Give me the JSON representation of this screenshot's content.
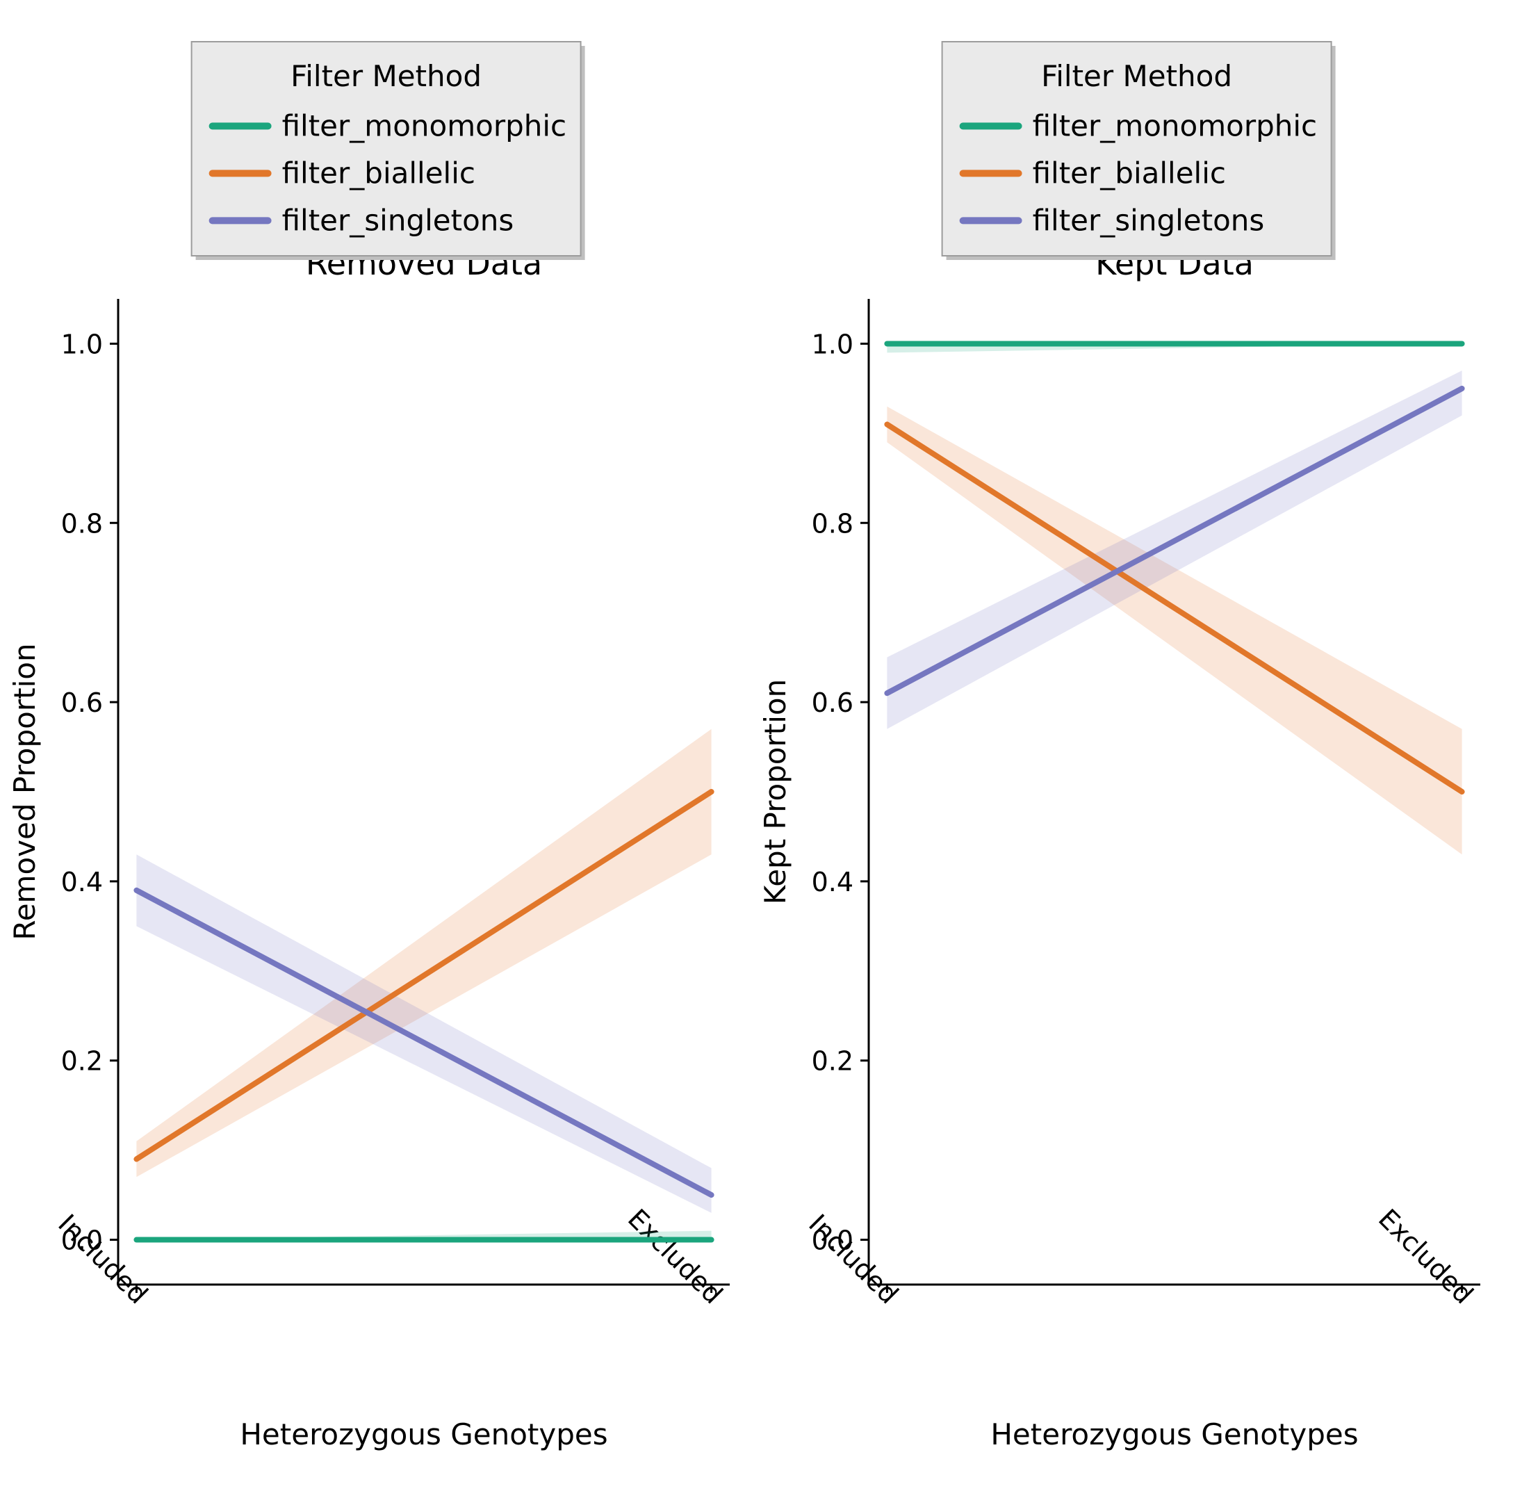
{
  "chart_data": [
    {
      "type": "line",
      "title": "Removed Data",
      "xlabel": "Heterozygous Genotypes",
      "ylabel": "Removed Proportion",
      "categories": [
        "Included",
        "Excluded"
      ],
      "ylim": [
        -0.05,
        1.05
      ],
      "y_ticks": [
        0.0,
        0.2,
        0.4,
        0.6,
        0.8,
        1.0
      ],
      "legend_title": "Filter Method",
      "series": [
        {
          "name": "filter_monomorphic",
          "color": "#1ba57d",
          "values": [
            0.0,
            0.0
          ],
          "ci_lo": [
            0.0,
            0.0
          ],
          "ci_hi": [
            0.0,
            0.01
          ]
        },
        {
          "name": "filter_biallelic",
          "color": "#e1772a",
          "values": [
            0.09,
            0.5
          ],
          "ci_lo": [
            0.07,
            0.43
          ],
          "ci_hi": [
            0.11,
            0.57
          ]
        },
        {
          "name": "filter_singletons",
          "color": "#7577c0",
          "values": [
            0.39,
            0.05
          ],
          "ci_lo": [
            0.35,
            0.03
          ],
          "ci_hi": [
            0.43,
            0.08
          ]
        }
      ]
    },
    {
      "type": "line",
      "title": "Kept Data",
      "xlabel": "Heterozygous Genotypes",
      "ylabel": "Kept Proportion",
      "categories": [
        "Included",
        "Excluded"
      ],
      "ylim": [
        -0.05,
        1.05
      ],
      "y_ticks": [
        0.0,
        0.2,
        0.4,
        0.6,
        0.8,
        1.0
      ],
      "legend_title": "Filter Method",
      "series": [
        {
          "name": "filter_monomorphic",
          "color": "#1ba57d",
          "values": [
            1.0,
            1.0
          ],
          "ci_lo": [
            0.99,
            1.0
          ],
          "ci_hi": [
            1.0,
            1.0
          ]
        },
        {
          "name": "filter_biallelic",
          "color": "#e1772a",
          "values": [
            0.91,
            0.5
          ],
          "ci_lo": [
            0.89,
            0.43
          ],
          "ci_hi": [
            0.93,
            0.57
          ]
        },
        {
          "name": "filter_singletons",
          "color": "#7577c0",
          "values": [
            0.61,
            0.95
          ],
          "ci_lo": [
            0.57,
            0.92
          ],
          "ci_hi": [
            0.65,
            0.97
          ]
        }
      ]
    }
  ]
}
